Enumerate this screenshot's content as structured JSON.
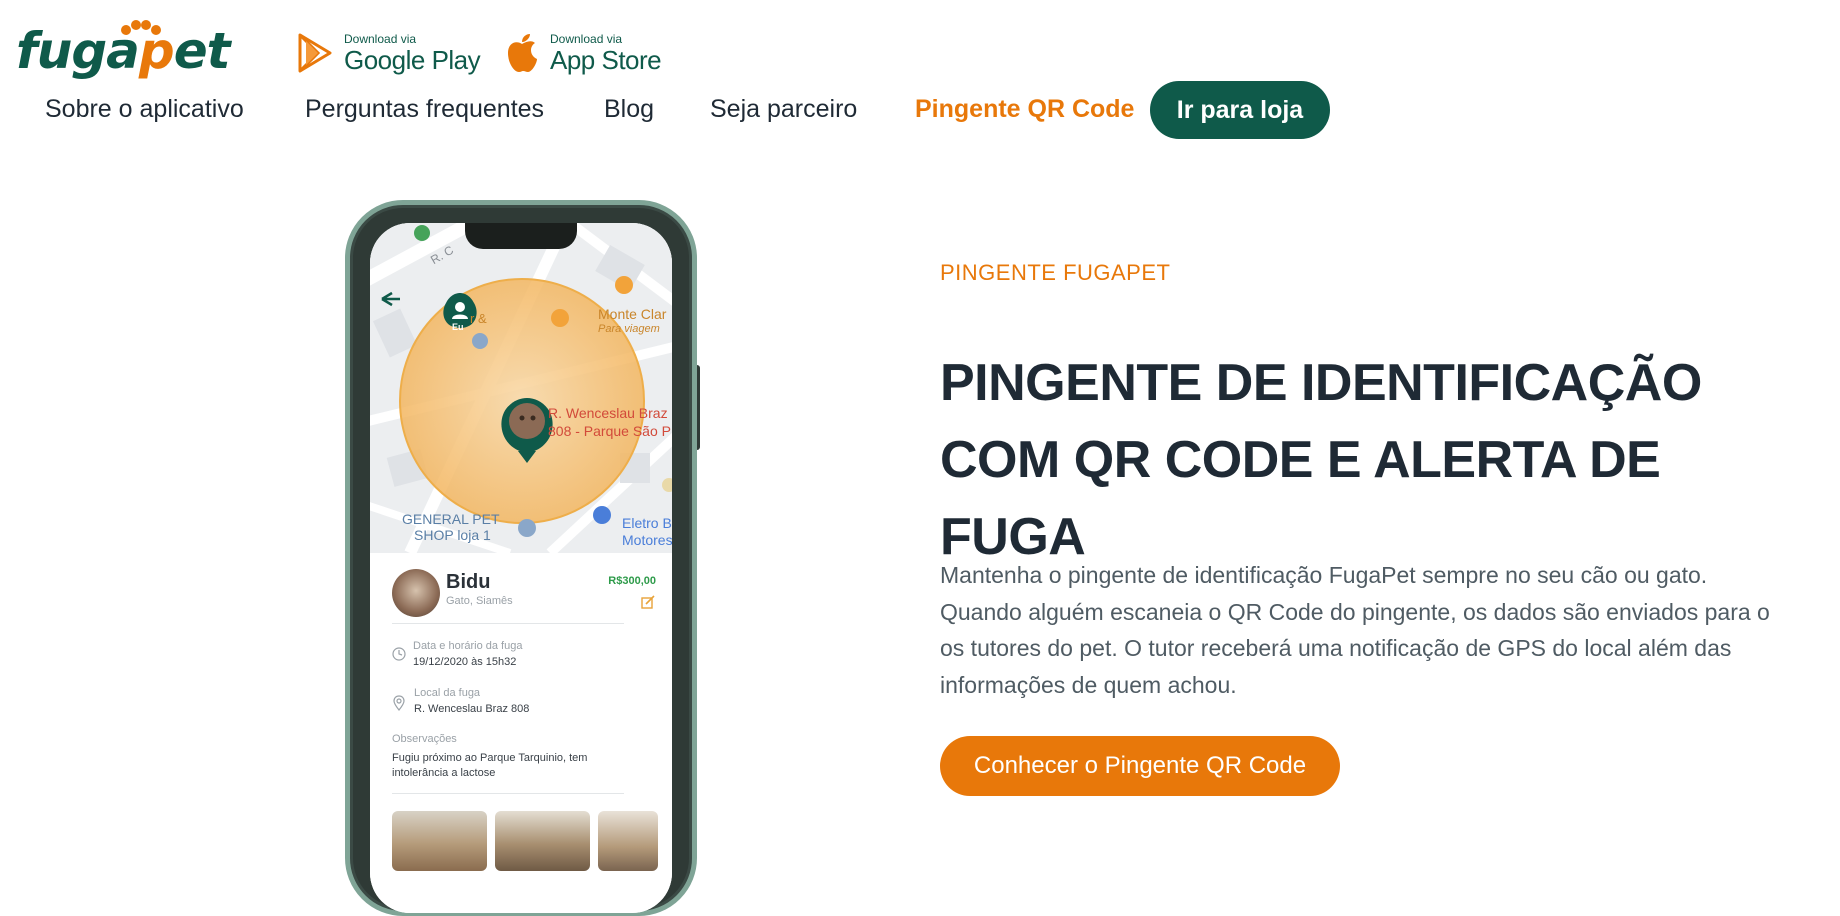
{
  "brand": {
    "name_part1": "fuga",
    "name_part2": "p",
    "name_part3": "et"
  },
  "store_links": {
    "google_play": {
      "prefix": "Download via",
      "name": "Google Play"
    },
    "app_store": {
      "prefix": "Download via",
      "name": "App Store"
    }
  },
  "nav": {
    "items": [
      "Sobre o aplicativo",
      "Perguntas frequentes",
      "Blog",
      "Seja parceiro",
      "Pingente QR Code"
    ],
    "cta": "Ir para loja"
  },
  "hero": {
    "tagline": "PINGENTE FUGAPET",
    "title": "PINGENTE DE IDENTIFICAÇÃO COM QR CODE E ALERTA DE FUGA",
    "description": "Mantenha o pingente de identificação FugaPet sempre no seu cão ou gato. Quando alguém escaneia o QR Code do pingente, os dados são enviados para o os tutores do pet. O tutor receberá uma notificação de GPS do local além das informações de quem achou.",
    "cta": "Conhecer o Pingente QR Code"
  },
  "phone": {
    "map_labels": {
      "road": "R. C",
      "monte": "Monte Clar",
      "para_viagem": "Para viagem",
      "street1": "R. Wenceslau Braz",
      "street2": "808 - Parque São P",
      "shop1": "GENERAL PET",
      "shop2": "SHOP loja 1",
      "eletro1": "Eletro B",
      "eletro2": "Motores",
      "marker_eu": "Eu",
      "amp": "r &"
    },
    "pet": {
      "name": "Bidu",
      "breed": "Gato, Siamês",
      "reward": "R$300,00"
    },
    "fields": {
      "date_label": "Data e horário da fuga",
      "date_value": "19/12/2020 às 15h32",
      "place_label": "Local da fuga",
      "place_value": "R. Wenceslau Braz 808",
      "obs_label": "Observações",
      "obs_value": "Fugiu próximo ao Parque Tarquinio, tem intolerância a lactose"
    }
  },
  "colors": {
    "brand_green": "#0f5a4a",
    "brand_orange": "#e8780a",
    "text_dark": "#1f2a35"
  }
}
